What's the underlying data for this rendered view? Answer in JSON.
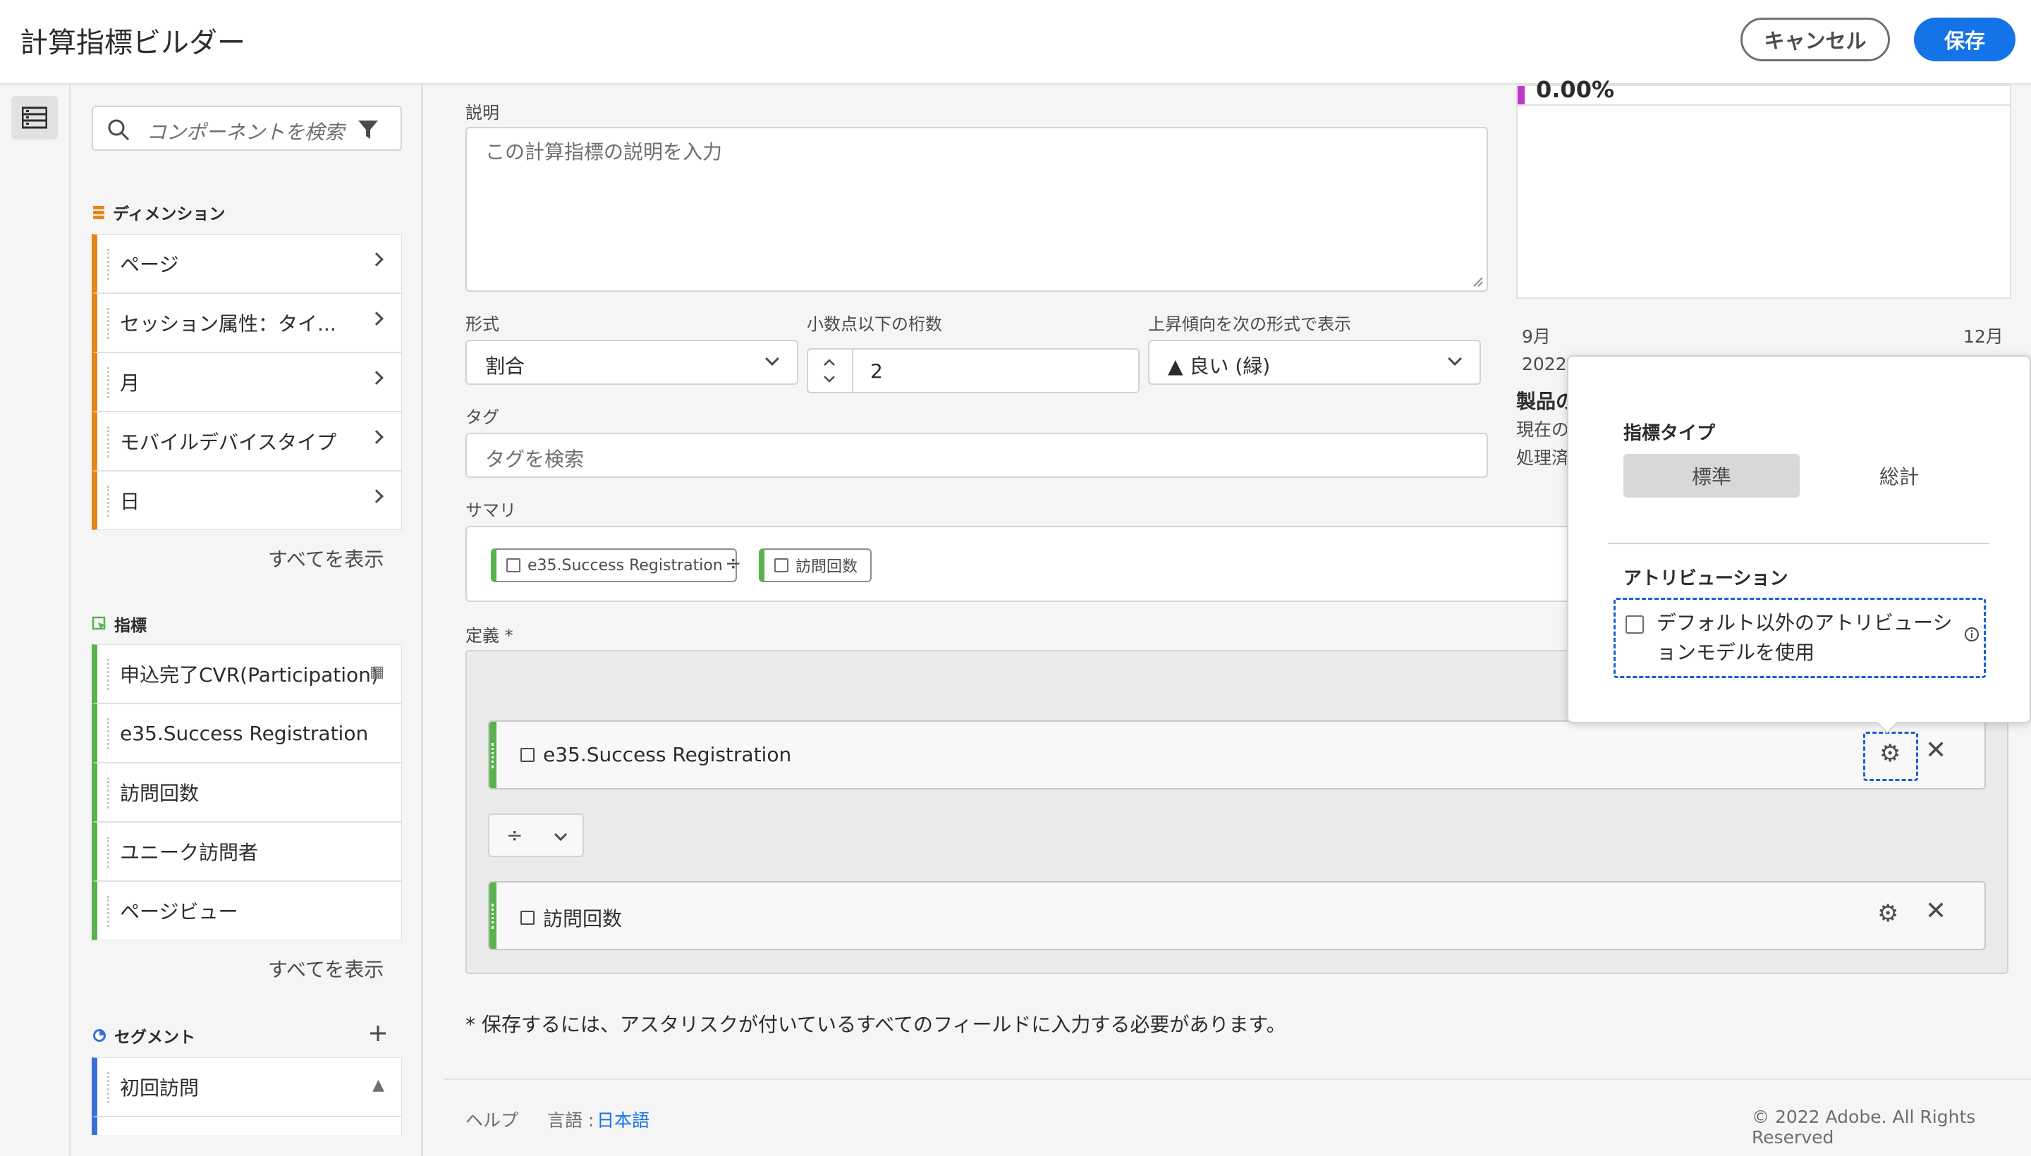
{
  "header": {
    "title": "計算指標ビルダー",
    "cancel_label": "キャンセル",
    "save_label": "保存"
  },
  "search": {
    "placeholder": "コンポーネントを検索"
  },
  "dimensions": {
    "title": "ディメンション",
    "items": [
      {
        "label": "ページ"
      },
      {
        "label": "セッション属性：タイ..."
      },
      {
        "label": "月"
      },
      {
        "label": "モバイルデバイスタイプ"
      },
      {
        "label": "日"
      }
    ],
    "show_all": "すべてを表示"
  },
  "metrics": {
    "title": "指標",
    "items": [
      {
        "label": "申込完了CVR(Participation)"
      },
      {
        "label": "e35.Success Registration"
      },
      {
        "label": "訪問回数"
      },
      {
        "label": "ユニーク訪問者"
      },
      {
        "label": "ページビュー"
      }
    ],
    "show_all": "すべてを表示"
  },
  "segments": {
    "title": "セグメント",
    "items": [
      {
        "label": "初回訪問"
      }
    ]
  },
  "form": {
    "description_label": "説明",
    "description_placeholder": "この計算指標の説明を入力",
    "format_label": "形式",
    "format_value": "割合",
    "decimals_label": "小数点以下の桁数",
    "decimals_value": "2",
    "trend_label": "上昇傾向を次の形式で表示",
    "trend_value": "▲ 良い (緑)",
    "tags_label": "タグ",
    "tags_placeholder": "タグを検索",
    "summary_label": "サマリ",
    "summary_left": "e35.Success Registration",
    "summary_operator": "÷",
    "summary_right": "訪問回数",
    "definition_label": "定義 *",
    "def_metric_1": "e35.Success Registration",
    "def_operator": "÷",
    "def_metric_2": "訪問回数",
    "required_note": "* 保存するには、アスタリスクが付いているすべてのフィールドに入力する必要があります。"
  },
  "preview": {
    "value": "0.00%",
    "x_start": "9月",
    "x_start_year": "2022",
    "x_end": "12月",
    "heading_partial": "製品の",
    "line1_partial": "現在の",
    "line2_partial": "処理済"
  },
  "popover": {
    "metric_type_label": "指標タイプ",
    "standard_label": "標準",
    "total_label": "総計",
    "attribution_label": "アトリビューション",
    "attribution_checkbox_line1": "デフォルト以外のアトリビューシ",
    "attribution_checkbox_line2": "ョンモデルを使用"
  },
  "footer": {
    "help": "ヘルプ",
    "language_label": "言語 :",
    "language_value": "日本語",
    "copyright": "© 2022 Adobe. All Rights Reserved"
  },
  "colors": {
    "accent": "#1473e6",
    "dimension": "#e68619",
    "metric": "#58b24e",
    "segment": "#3a6fd8",
    "preview_bar": "#c038cc"
  }
}
